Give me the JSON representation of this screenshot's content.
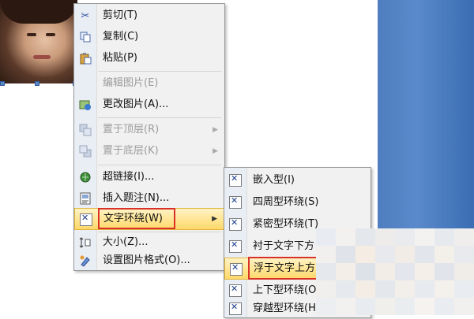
{
  "context_menu": {
    "items": [
      {
        "label": "剪切(T)",
        "icon": "scissors-icon",
        "enabled": true
      },
      {
        "label": "复制(C)",
        "icon": "copy-icon",
        "enabled": true
      },
      {
        "label": "粘贴(P)",
        "icon": "paste-icon",
        "enabled": true
      },
      {
        "label": "编辑图片(E)",
        "icon": "",
        "enabled": false
      },
      {
        "label": "更改图片(A)...",
        "icon": "change-picture-icon",
        "enabled": true
      },
      {
        "label": "置于顶层(R)",
        "icon": "bring-to-front-icon",
        "enabled": false
      },
      {
        "label": "置于底层(K)",
        "icon": "send-to-back-icon",
        "enabled": false
      },
      {
        "label": "超链接(I)...",
        "icon": "hyperlink-icon",
        "enabled": true
      },
      {
        "label": "插入题注(N)...",
        "icon": "caption-icon",
        "enabled": true
      },
      {
        "label": "文字环绕(W)",
        "icon": "text-wrap-icon",
        "enabled": true
      },
      {
        "label": "大小(Z)...",
        "icon": "size-icon",
        "enabled": true
      },
      {
        "label": "设置图片格式(O)...",
        "icon": "format-picture-icon",
        "enabled": true
      }
    ]
  },
  "submenu": {
    "items": [
      {
        "label": "嵌入型(I)"
      },
      {
        "label": "四周型环绕(S)"
      },
      {
        "label": "紧密型环绕(T)"
      },
      {
        "label": "衬于文字下方"
      },
      {
        "label": "浮于文字上方"
      },
      {
        "label": "上下型环绕(O)"
      },
      {
        "label": "穿越型环绕(H)"
      }
    ]
  },
  "colors": {
    "highlight_border": "#d93028",
    "menu_background": "#f1f1f1",
    "hover_gradient": "#ffd86a",
    "side_panel": "#4f7dbf"
  }
}
